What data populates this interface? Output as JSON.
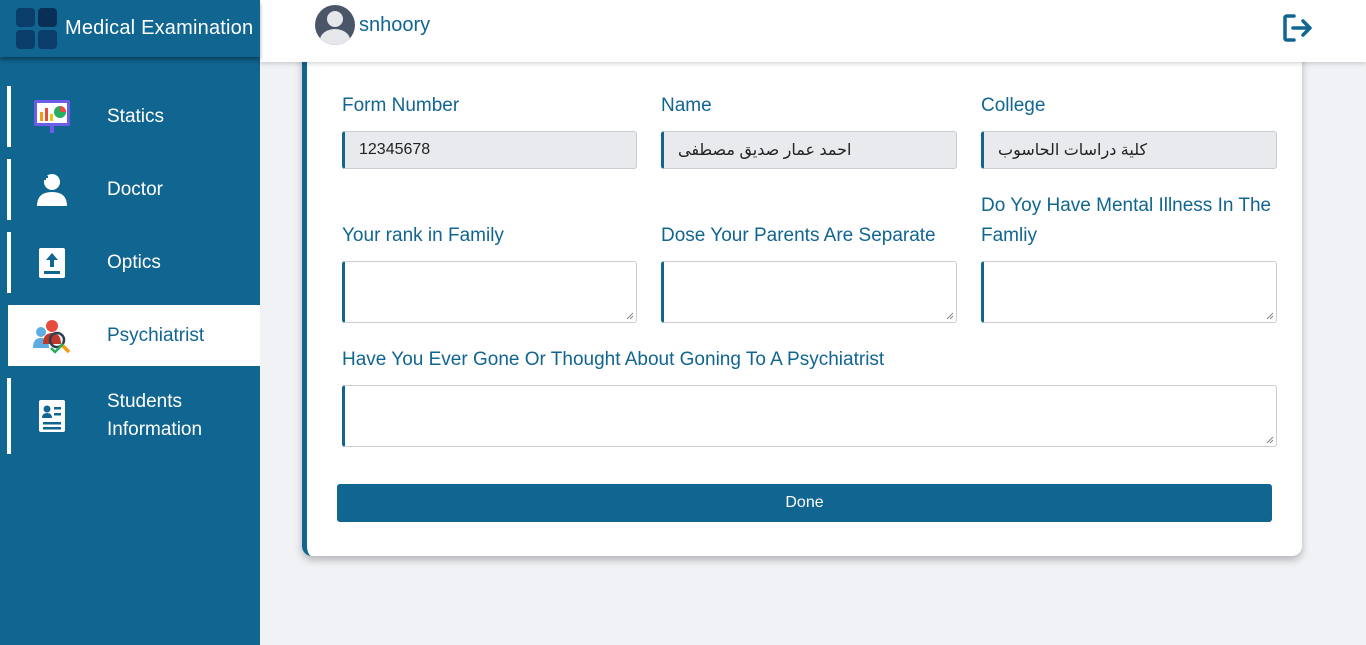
{
  "app": {
    "title": "Medical Examination"
  },
  "sidebar": {
    "items": [
      {
        "label": "Statics",
        "icon": "presentation-chart-icon"
      },
      {
        "label": "Doctor",
        "icon": "doctor-icon"
      },
      {
        "label": "Optics",
        "icon": "upload-book-icon"
      },
      {
        "label": "Psychiatrist",
        "icon": "psychiatrist-icon",
        "active": true
      },
      {
        "label": "Students Information",
        "icon": "student-id-icon"
      }
    ]
  },
  "header": {
    "username": "snhoory"
  },
  "form": {
    "form_number": {
      "label": "Form Number",
      "value": "12345678"
    },
    "name": {
      "label": "Name",
      "value": "احمد عمار صديق مصطفى"
    },
    "college": {
      "label": "College",
      "value": "كلية دراسات الحاسوب"
    },
    "rank": {
      "label": "Your rank in Family",
      "value": ""
    },
    "parents": {
      "label": "Dose Your Parents Are Separate",
      "value": ""
    },
    "mental": {
      "label": "Do Yoy Have Mental Illness In The Famliy",
      "value": ""
    },
    "psychiatrist": {
      "label": "Have You Ever Gone Or Thought About Goning To A Psychiatrist",
      "value": ""
    },
    "done_label": "Done"
  },
  "colors": {
    "primary": "#116591",
    "background": "#f0f2f5",
    "input_bg": "#e8eaed"
  }
}
